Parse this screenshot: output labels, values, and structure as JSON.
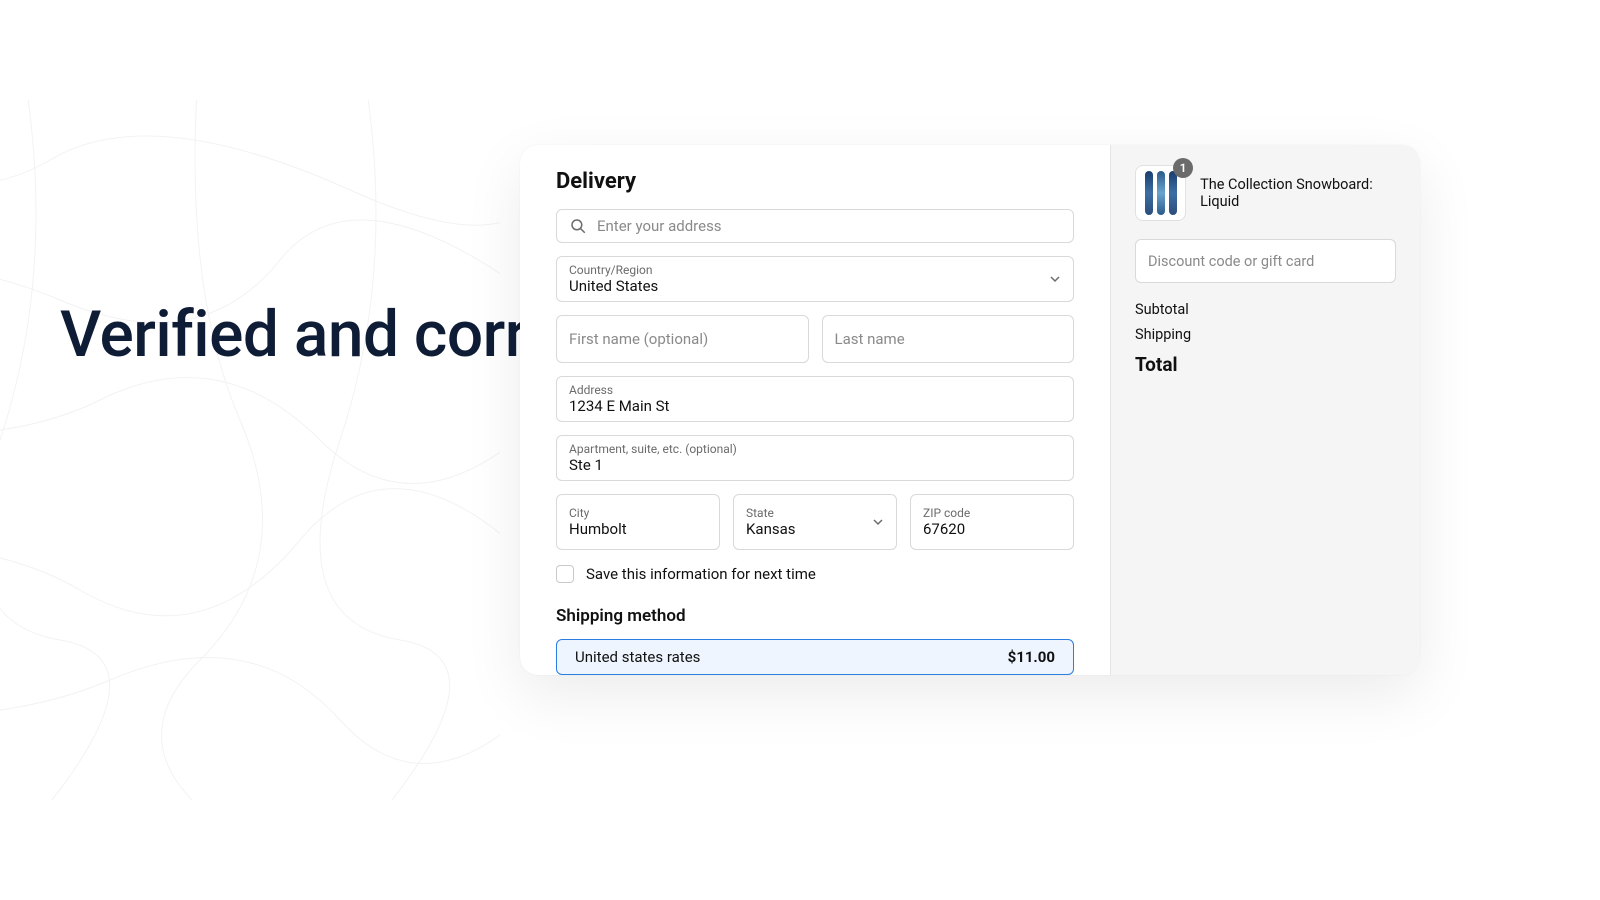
{
  "headline": "Verified and correctly formatted",
  "delivery": {
    "title": "Delivery",
    "address_search_placeholder": "Enter your address",
    "country_label": "Country/Region",
    "country_value": "United States",
    "first_name_placeholder": "First name (optional)",
    "last_name_placeholder": "Last name",
    "address_label": "Address",
    "address_value": "1234 E Main St",
    "apt_label": "Apartment, suite, etc. (optional)",
    "apt_value": "Ste 1",
    "city_label": "City",
    "city_value": "Humbolt",
    "state_label": "State",
    "state_value": "Kansas",
    "zip_label": "ZIP code",
    "zip_value": "67620",
    "save_info_label": "Save this information for next time"
  },
  "shipping": {
    "title": "Shipping method",
    "rate_name": "United states rates",
    "rate_price": "$11.00"
  },
  "summary": {
    "product_name": "The Collection Snowboard: Liquid",
    "qty_badge": "1",
    "discount_placeholder": "Discount code or gift card",
    "subtotal_label": "Subtotal",
    "shipping_label": "Shipping",
    "total_label": "Total"
  }
}
